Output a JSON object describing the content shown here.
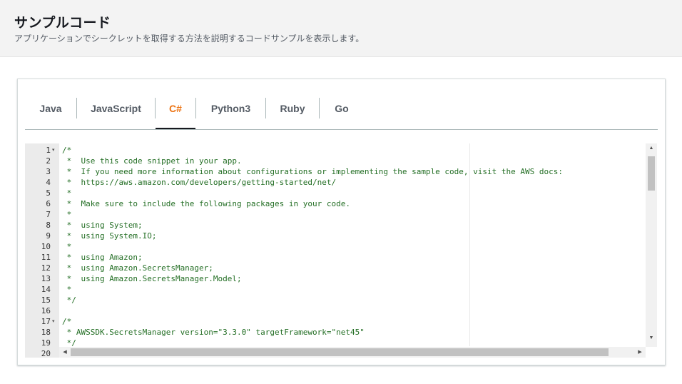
{
  "header": {
    "title": "サンプルコード",
    "description": "アプリケーションでシークレットを取得する方法を説明するコードサンプルを表示します。"
  },
  "tabs": [
    {
      "label": "Java",
      "active": false
    },
    {
      "label": "JavaScript",
      "active": false
    },
    {
      "label": "C#",
      "active": true
    },
    {
      "label": "Python3",
      "active": false
    },
    {
      "label": "Ruby",
      "active": false
    },
    {
      "label": "Go",
      "active": false
    }
  ],
  "colors": {
    "active_tab": "#ec7211",
    "code_comment": "#236e24",
    "gutter_bg": "#ebebeb"
  },
  "editor": {
    "line_numbers": [
      "1",
      "2",
      "3",
      "4",
      "5",
      "6",
      "7",
      "8",
      "9",
      "10",
      "11",
      "12",
      "13",
      "14",
      "15",
      "16",
      "17",
      "18",
      "19",
      "20"
    ],
    "fold_markers": {
      "1": "▾",
      "17": "▾"
    },
    "lines": [
      "/*",
      " *  Use this code snippet in your app.",
      " *  If you need more information about configurations or implementing the sample code, visit the AWS docs:",
      " *  https://aws.amazon.com/developers/getting-started/net/",
      " *",
      " *  Make sure to include the following packages in your code.",
      " *",
      " *  using System;",
      " *  using System.IO;",
      " *",
      " *  using Amazon;",
      " *  using Amazon.SecretsManager;",
      " *  using Amazon.SecretsManager.Model;",
      " *",
      " */",
      "",
      "/*",
      " * AWSSDK.SecretsManager version=\"3.3.0\" targetFramework=\"net45\"",
      " */",
      ""
    ],
    "scroll_icons": {
      "up": "▲",
      "down": "▼",
      "left": "◂",
      "right": "▸"
    }
  }
}
